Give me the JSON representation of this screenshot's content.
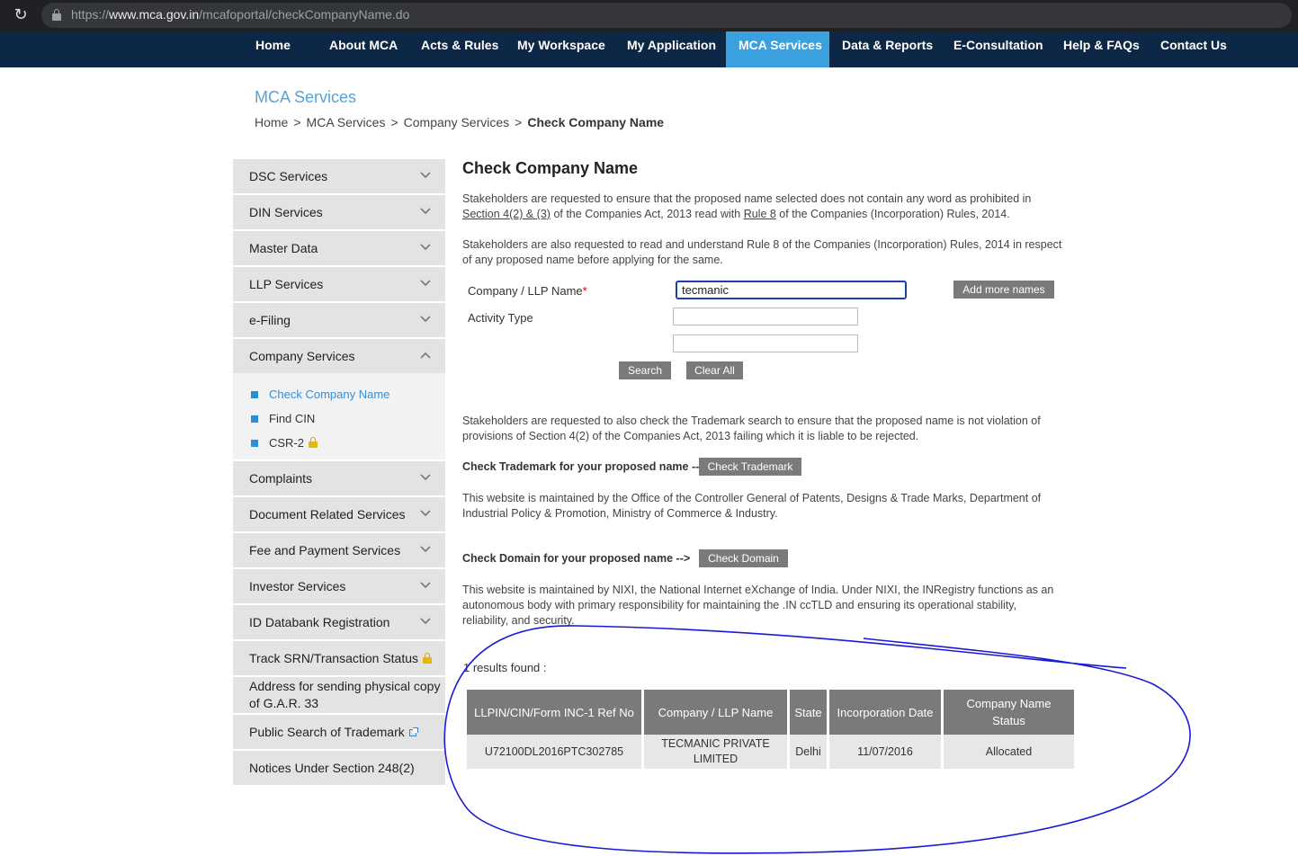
{
  "browser": {
    "url_prefix": "https://",
    "url_host": "www.mca.gov.in",
    "url_path": "/mcafoportal/checkCompanyName.do"
  },
  "nav": {
    "items": [
      {
        "label": "Home"
      },
      {
        "label": "About MCA"
      },
      {
        "label": "Acts & Rules"
      },
      {
        "label": "My Workspace"
      },
      {
        "label": "My Application"
      },
      {
        "label": "MCA Services",
        "active": true
      },
      {
        "label": "Data & Reports"
      },
      {
        "label": "E-Consultation"
      },
      {
        "label": "Help & FAQs"
      },
      {
        "label": "Contact Us"
      }
    ]
  },
  "header": {
    "section_title": "MCA Services",
    "breadcrumb": [
      "Home",
      "MCA Services",
      "Company Services",
      "Check Company Name"
    ],
    "breadcrumb_sep": ">"
  },
  "sidebar": {
    "items": [
      {
        "label": "DSC Services"
      },
      {
        "label": "DIN Services"
      },
      {
        "label": "Master Data"
      },
      {
        "label": "LLP Services"
      },
      {
        "label": "e-Filing"
      },
      {
        "label": "Company Services",
        "expanded": true
      },
      {
        "label": "Complaints"
      },
      {
        "label": "Document Related Services"
      },
      {
        "label": "Fee and Payment Services"
      },
      {
        "label": "Investor Services"
      },
      {
        "label": "ID Databank Registration"
      },
      {
        "label": "Track SRN/Transaction Status"
      },
      {
        "label": "Address for sending physical copy of G.A.R. 33"
      },
      {
        "label": "Public Search of Trademark"
      },
      {
        "label": "Notices Under Section 248(2)"
      }
    ],
    "submenu": [
      {
        "label": "Check Company Name",
        "active": true
      },
      {
        "label": "Find CIN"
      },
      {
        "label": "CSR-2"
      }
    ]
  },
  "main": {
    "title": "Check Company Name",
    "para1_a": "Stakeholders are requested to ensure that the proposed name selected does not contain any word as prohibited in",
    "para1_link1": "Section 4(2) & (3)",
    "para1_b": " of the Companies Act, 2013 read with ",
    "para1_link2": "Rule 8",
    "para1_c": " of the Companies (Incorporation) Rules, 2014.",
    "para2": "Stakeholders are also requested to read and understand Rule 8 of the Companies (Incorporation) Rules, 2014 in respect of any proposed name before applying for the same.",
    "form": {
      "name_label": "Company / LLP Name",
      "required_mark": "*",
      "name_value": "tecmanic",
      "activity_label": "Activity Type",
      "activity_value": "",
      "activity_value2": "",
      "add_more_label": "Add more names",
      "search_label": "Search",
      "clear_label": "Clear All"
    },
    "para3": "Stakeholders are requested to also check the Trademark search to ensure that the proposed name is not violation of provisions of Section 4(2) of the Companies Act, 2013 failing which it is liable to be rejected.",
    "trademark_prompt": "Check Trademark for your proposed name -->",
    "trademark_button": "Check Trademark",
    "para4": "This website is maintained by the Office of the Controller General of Patents, Designs & Trade Marks, Department of Industrial Policy & Promotion, Ministry of Commerce & Industry.",
    "domain_prompt": "Check Domain for your proposed name -->",
    "domain_button": "Check Domain",
    "para5": "This website is maintained by NIXI, the National Internet eXchange of India. Under NIXI, the INRegistry functions as an autonomous body with primary responsibility for maintaining the .IN ccTLD and ensuring its operational stability, reliability, and security.",
    "results_text": "1 results found :",
    "table": {
      "headers": [
        "LLPIN/CIN/Form INC-1 Ref No",
        "Company / LLP Name",
        "State",
        "Incorporation Date",
        "Company Name Status"
      ],
      "rows": [
        [
          "U72100DL2016PTC302785",
          "TECMANIC PRIVATE LIMITED",
          "Delhi",
          "11/07/2016",
          "Allocated"
        ]
      ]
    }
  },
  "colors": {
    "navbar": "#0d2747",
    "nav_active": "#3aa0de",
    "annotation": "#1a1ad6"
  }
}
